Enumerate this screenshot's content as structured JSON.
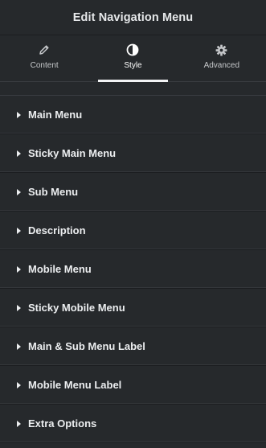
{
  "header": {
    "title": "Edit Navigation Menu"
  },
  "tabs": [
    {
      "label": "Content",
      "icon": "pencil-icon",
      "active": false
    },
    {
      "label": "Style",
      "icon": "half-circle-contrast-icon",
      "active": true
    },
    {
      "label": "Advanced",
      "icon": "gear-icon",
      "active": false
    }
  ],
  "sections": [
    {
      "label": "Main Menu"
    },
    {
      "label": "Sticky Main Menu"
    },
    {
      "label": "Sub Menu"
    },
    {
      "label": "Description"
    },
    {
      "label": "Mobile Menu"
    },
    {
      "label": "Sticky Mobile Menu"
    },
    {
      "label": "Main & Sub Menu Label"
    },
    {
      "label": "Mobile Menu Label"
    },
    {
      "label": "Extra Options"
    }
  ],
  "colors": {
    "background": "#26292c",
    "text": "#eceef0",
    "active_indicator": "#f2f3f4"
  }
}
